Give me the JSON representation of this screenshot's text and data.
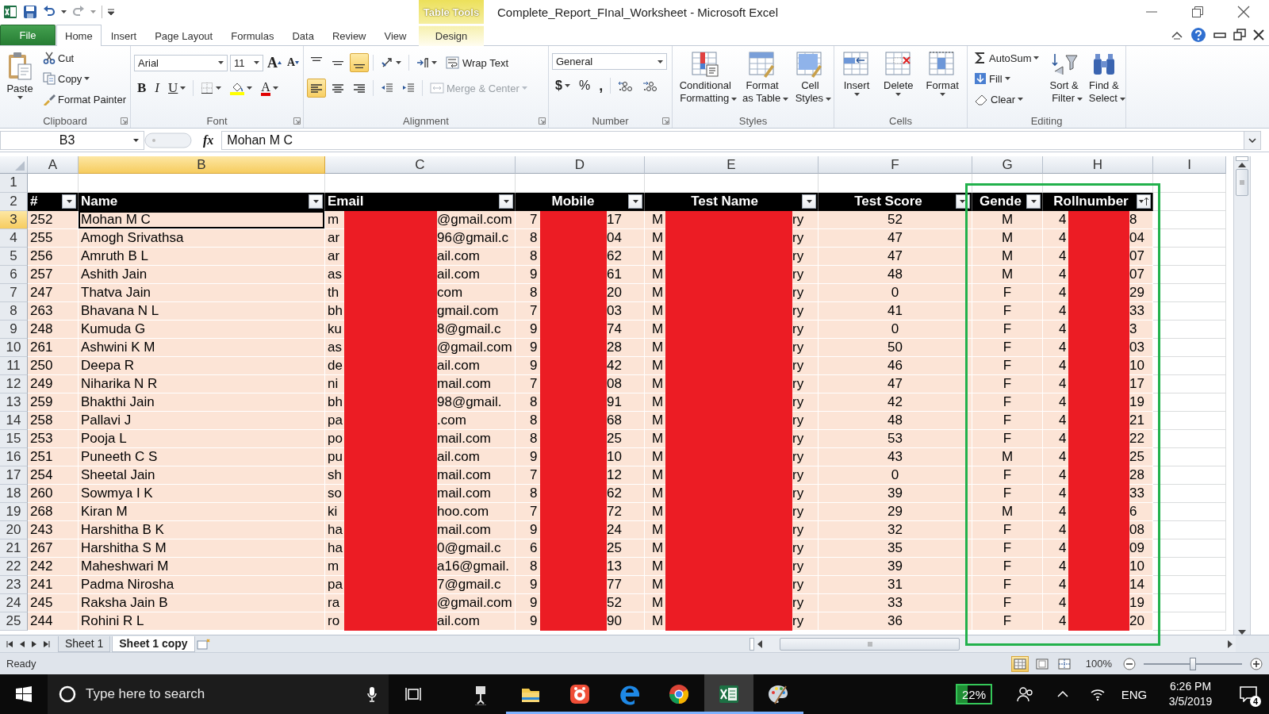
{
  "title_bar": {
    "context_tab": "Table Tools",
    "title": "Complete_Report_FInal_Worksheet - Microsoft Excel"
  },
  "ribbon_tabs": [
    {
      "label": "File",
      "kind": "file",
      "selected": false
    },
    {
      "label": "Home",
      "kind": "normal",
      "selected": true
    },
    {
      "label": "Insert",
      "kind": "normal",
      "selected": false
    },
    {
      "label": "Page Layout",
      "kind": "normal",
      "selected": false
    },
    {
      "label": "Formulas",
      "kind": "normal",
      "selected": false
    },
    {
      "label": "Data",
      "kind": "normal",
      "selected": false
    },
    {
      "label": "Review",
      "kind": "normal",
      "selected": false
    },
    {
      "label": "View",
      "kind": "normal",
      "selected": false
    },
    {
      "label": "Design",
      "kind": "contextual",
      "selected": false
    }
  ],
  "ribbon_groups": [
    {
      "kind": "clipboard",
      "label": "Clipboard",
      "launcher": true,
      "paste": "Paste",
      "cut": "Cut",
      "copy": "Copy",
      "format_painter": "Format Painter"
    },
    {
      "kind": "font",
      "label": "Font",
      "launcher": true,
      "font_name": "Arial",
      "font_size": "11",
      "grow": "A",
      "shrink": "A",
      "bold": "B",
      "italic": "I",
      "underline": "U",
      "font_color": "A"
    },
    {
      "kind": "alignment",
      "label": "Alignment",
      "launcher": true,
      "vertical_align": [
        {
          "selected": false
        },
        {
          "selected": false
        },
        {
          "selected": true
        }
      ],
      "horizontal_align": [
        {
          "selected": true
        },
        {
          "selected": false
        },
        {
          "selected": false
        }
      ],
      "wrap_text": "Wrap Text",
      "merge": {
        "label": "Merge & Center",
        "disabled": true
      }
    },
    {
      "kind": "number",
      "label": "Number",
      "launcher": true,
      "format": "General",
      "currency": "$",
      "percent": "%",
      "comma": ","
    },
    {
      "kind": "styles",
      "label": "Styles",
      "launcher": false,
      "buttons": [
        "Conditional Formatting",
        "Format as Table",
        "Cell Styles"
      ]
    },
    {
      "kind": "cells",
      "label": "Cells",
      "launcher": false,
      "buttons": [
        "Insert",
        "Delete",
        "Format"
      ]
    },
    {
      "kind": "editing",
      "label": "Editing",
      "launcher": false,
      "small": [
        "AutoSum",
        "Fill",
        "Clear"
      ],
      "large": [
        "Sort & Filter",
        "Find & Select"
      ]
    }
  ],
  "formula_bar": {
    "name_box": "B3",
    "fx": "fx",
    "formula": "Mohan M C"
  },
  "sheet": {
    "columns": [
      {
        "letter": "A",
        "selected": false,
        "highlighted": false
      },
      {
        "letter": "B",
        "selected": true,
        "highlighted": false
      },
      {
        "letter": "C",
        "selected": false,
        "highlighted": false
      },
      {
        "letter": "D",
        "selected": false,
        "highlighted": false
      },
      {
        "letter": "E",
        "selected": false,
        "highlighted": false
      },
      {
        "letter": "F",
        "selected": false,
        "highlighted": false
      },
      {
        "letter": "G",
        "selected": false,
        "highlighted": true
      },
      {
        "letter": "H",
        "selected": false,
        "highlighted": true
      },
      {
        "letter": "I",
        "selected": false,
        "highlighted": false
      }
    ],
    "empty_row": {
      "row_number": "1"
    },
    "header_row": {
      "row_number": "2",
      "cells": [
        {
          "label": "#",
          "sorted": false
        },
        {
          "label": "Name",
          "sorted": false
        },
        {
          "label": "Email",
          "sorted": false
        },
        {
          "label": "Mobile",
          "sorted": false
        },
        {
          "label": "Test Name",
          "sorted": false
        },
        {
          "label": "Test Score",
          "sorted": false
        },
        {
          "label": "Gende",
          "sorted": false
        },
        {
          "label": "Rollnumber",
          "sorted": true
        }
      ]
    },
    "rows": [
      {
        "row_number": "3",
        "selected": true,
        "num": "252",
        "name": "Mohan M C",
        "email_start": "m",
        "email_end": "@gmail.com",
        "mobile_start": "7",
        "mobile_end": "17",
        "test_start": "M",
        "test_end": "ry",
        "score": "52",
        "gender": "M",
        "roll_start": "4",
        "roll_end": "8"
      },
      {
        "row_number": "4",
        "selected": false,
        "num": "255",
        "name": "Amogh Srivathsa",
        "email_start": "ar",
        "email_end": "96@gmail.c",
        "mobile_start": "8",
        "mobile_end": "04",
        "test_start": "M",
        "test_end": "ry",
        "score": "47",
        "gender": "M",
        "roll_start": "4",
        "roll_end": "04"
      },
      {
        "row_number": "5",
        "selected": false,
        "num": "256",
        "name": "Amruth B L",
        "email_start": "ar",
        "email_end": "ail.com",
        "mobile_start": "8",
        "mobile_end": "62",
        "test_start": "M",
        "test_end": "ry",
        "score": "47",
        "gender": "M",
        "roll_start": "4",
        "roll_end": "07"
      },
      {
        "row_number": "6",
        "selected": false,
        "num": "257",
        "name": "Ashith Jain",
        "email_start": "as",
        "email_end": "ail.com",
        "mobile_start": "9",
        "mobile_end": "61",
        "test_start": "M",
        "test_end": "ry",
        "score": "48",
        "gender": "M",
        "roll_start": "4",
        "roll_end": "07"
      },
      {
        "row_number": "7",
        "selected": false,
        "num": "247",
        "name": "Thatva Jain",
        "email_start": "th",
        "email_end": "com",
        "mobile_start": "8",
        "mobile_end": "20",
        "test_start": "M",
        "test_end": "ry",
        "score": "0",
        "gender": "F",
        "roll_start": "4",
        "roll_end": "29"
      },
      {
        "row_number": "8",
        "selected": false,
        "num": "263",
        "name": "Bhavana N L",
        "email_start": "bh",
        "email_end": "gmail.com",
        "mobile_start": "7",
        "mobile_end": "03",
        "test_start": "M",
        "test_end": "ry",
        "score": "41",
        "gender": "F",
        "roll_start": "4",
        "roll_end": "33"
      },
      {
        "row_number": "9",
        "selected": false,
        "num": "248",
        "name": "Kumuda G",
        "email_start": "ku",
        "email_end": "8@gmail.c",
        "mobile_start": "9",
        "mobile_end": "74",
        "test_start": "M",
        "test_end": "ry",
        "score": "0",
        "gender": "F",
        "roll_start": "4",
        "roll_end": "3"
      },
      {
        "row_number": "10",
        "selected": false,
        "num": "261",
        "name": "Ashwini K M",
        "email_start": "as",
        "email_end": "@gmail.com",
        "mobile_start": "9",
        "mobile_end": "28",
        "test_start": "M",
        "test_end": "ry",
        "score": "50",
        "gender": "F",
        "roll_start": "4",
        "roll_end": "03"
      },
      {
        "row_number": "11",
        "selected": false,
        "num": "250",
        "name": "Deepa R",
        "email_start": "de",
        "email_end": "ail.com",
        "mobile_start": "9",
        "mobile_end": "42",
        "test_start": "M",
        "test_end": "ry",
        "score": "46",
        "gender": "F",
        "roll_start": "4",
        "roll_end": "10"
      },
      {
        "row_number": "12",
        "selected": false,
        "num": "249",
        "name": "Niharika N R",
        "email_start": "ni",
        "email_end": "mail.com",
        "mobile_start": "7",
        "mobile_end": "08",
        "test_start": "M",
        "test_end": "ry",
        "score": "47",
        "gender": "F",
        "roll_start": "4",
        "roll_end": "17"
      },
      {
        "row_number": "13",
        "selected": false,
        "num": "259",
        "name": "Bhakthi Jain",
        "email_start": "bh",
        "email_end": "98@gmail.",
        "mobile_start": "8",
        "mobile_end": "91",
        "test_start": "M",
        "test_end": "ry",
        "score": "42",
        "gender": "F",
        "roll_start": "4",
        "roll_end": "19"
      },
      {
        "row_number": "14",
        "selected": false,
        "num": "258",
        "name": "Pallavi J",
        "email_start": "pa",
        "email_end": ".com",
        "mobile_start": "8",
        "mobile_end": "68",
        "test_start": "M",
        "test_end": "ry",
        "score": "48",
        "gender": "F",
        "roll_start": "4",
        "roll_end": "21"
      },
      {
        "row_number": "15",
        "selected": false,
        "num": "253",
        "name": "Pooja L",
        "email_start": "po",
        "email_end": "mail.com",
        "mobile_start": "8",
        "mobile_end": "25",
        "test_start": "M",
        "test_end": "ry",
        "score": "53",
        "gender": "F",
        "roll_start": "4",
        "roll_end": "22"
      },
      {
        "row_number": "16",
        "selected": false,
        "num": "251",
        "name": "Puneeth C S",
        "email_start": "pu",
        "email_end": "ail.com",
        "mobile_start": "9",
        "mobile_end": "10",
        "test_start": "M",
        "test_end": "ry",
        "score": "43",
        "gender": "M",
        "roll_start": "4",
        "roll_end": "25"
      },
      {
        "row_number": "17",
        "selected": false,
        "num": "254",
        "name": "Sheetal Jain",
        "email_start": "sh",
        "email_end": "mail.com",
        "mobile_start": "7",
        "mobile_end": "12",
        "test_start": "M",
        "test_end": "ry",
        "score": "0",
        "gender": "F",
        "roll_start": "4",
        "roll_end": "28"
      },
      {
        "row_number": "18",
        "selected": false,
        "num": "260",
        "name": "Sowmya I K",
        "email_start": "so",
        "email_end": "mail.com",
        "mobile_start": "8",
        "mobile_end": "62",
        "test_start": "M",
        "test_end": "ry",
        "score": "39",
        "gender": "F",
        "roll_start": "4",
        "roll_end": "33"
      },
      {
        "row_number": "19",
        "selected": false,
        "num": "268",
        "name": "Kiran M",
        "email_start": "ki",
        "email_end": "hoo.com",
        "mobile_start": "7",
        "mobile_end": "72",
        "test_start": "M",
        "test_end": "ry",
        "score": "29",
        "gender": "M",
        "roll_start": "4",
        "roll_end": "6"
      },
      {
        "row_number": "20",
        "selected": false,
        "num": "243",
        "name": "Harshitha B K",
        "email_start": "ha",
        "email_end": "mail.com",
        "mobile_start": "9",
        "mobile_end": "24",
        "test_start": "M",
        "test_end": "ry",
        "score": "32",
        "gender": "F",
        "roll_start": "4",
        "roll_end": "08"
      },
      {
        "row_number": "21",
        "selected": false,
        "num": "267",
        "name": "Harshitha S M",
        "email_start": "ha",
        "email_end": "0@gmail.c",
        "mobile_start": "6",
        "mobile_end": "25",
        "test_start": "M",
        "test_end": "ry",
        "score": "35",
        "gender": "F",
        "roll_start": "4",
        "roll_end": "09"
      },
      {
        "row_number": "22",
        "selected": false,
        "num": "242",
        "name": "Maheshwari M",
        "email_start": "m",
        "email_end": "a16@gmail.",
        "mobile_start": "8",
        "mobile_end": "13",
        "test_start": "M",
        "test_end": "ry",
        "score": "39",
        "gender": "F",
        "roll_start": "4",
        "roll_end": "10"
      },
      {
        "row_number": "23",
        "selected": false,
        "num": "241",
        "name": "Padma Nirosha",
        "email_start": "pa",
        "email_end": "7@gmail.c",
        "mobile_start": "9",
        "mobile_end": "77",
        "test_start": "M",
        "test_end": "ry",
        "score": "31",
        "gender": "F",
        "roll_start": "4",
        "roll_end": "14"
      },
      {
        "row_number": "24",
        "selected": false,
        "num": "245",
        "name": "Raksha Jain B",
        "email_start": "ra",
        "email_end": "@gmail.com",
        "mobile_start": "9",
        "mobile_end": "52",
        "test_start": "M",
        "test_end": "ry",
        "score": "33",
        "gender": "F",
        "roll_start": "4",
        "roll_end": "19"
      },
      {
        "row_number": "25",
        "selected": false,
        "num": "244",
        "name": "Rohini R L",
        "email_start": "ro",
        "email_end": "ail.com",
        "mobile_start": "9",
        "mobile_end": "90",
        "test_start": "M",
        "test_end": "ry",
        "score": "36",
        "gender": "F",
        "roll_start": "4",
        "roll_end": "20"
      }
    ]
  },
  "sheet_tabs": [
    {
      "label": "Sheet 1",
      "selected": false
    },
    {
      "label": "Sheet 1 copy",
      "selected": true
    }
  ],
  "status_bar": {
    "status": "Ready",
    "views": [
      {
        "selected": true
      },
      {
        "selected": false
      },
      {
        "selected": false
      }
    ],
    "zoom": "100%",
    "zoom_slider": {
      "level": 0.5
    }
  },
  "taskbar": {
    "search_placeholder": "Type here to search",
    "apps": [
      {
        "running": false,
        "selected": false
      },
      {
        "running": true,
        "selected": false
      },
      {
        "running": true,
        "selected": false
      },
      {
        "running": true,
        "selected": false
      },
      {
        "running": true,
        "selected": false
      },
      {
        "running": true,
        "selected": true
      },
      {
        "running": true,
        "selected": false
      }
    ],
    "battery": "22%",
    "language": "ENG",
    "time": "6:26 PM",
    "date": "3/5/2019",
    "notifications": "4"
  }
}
